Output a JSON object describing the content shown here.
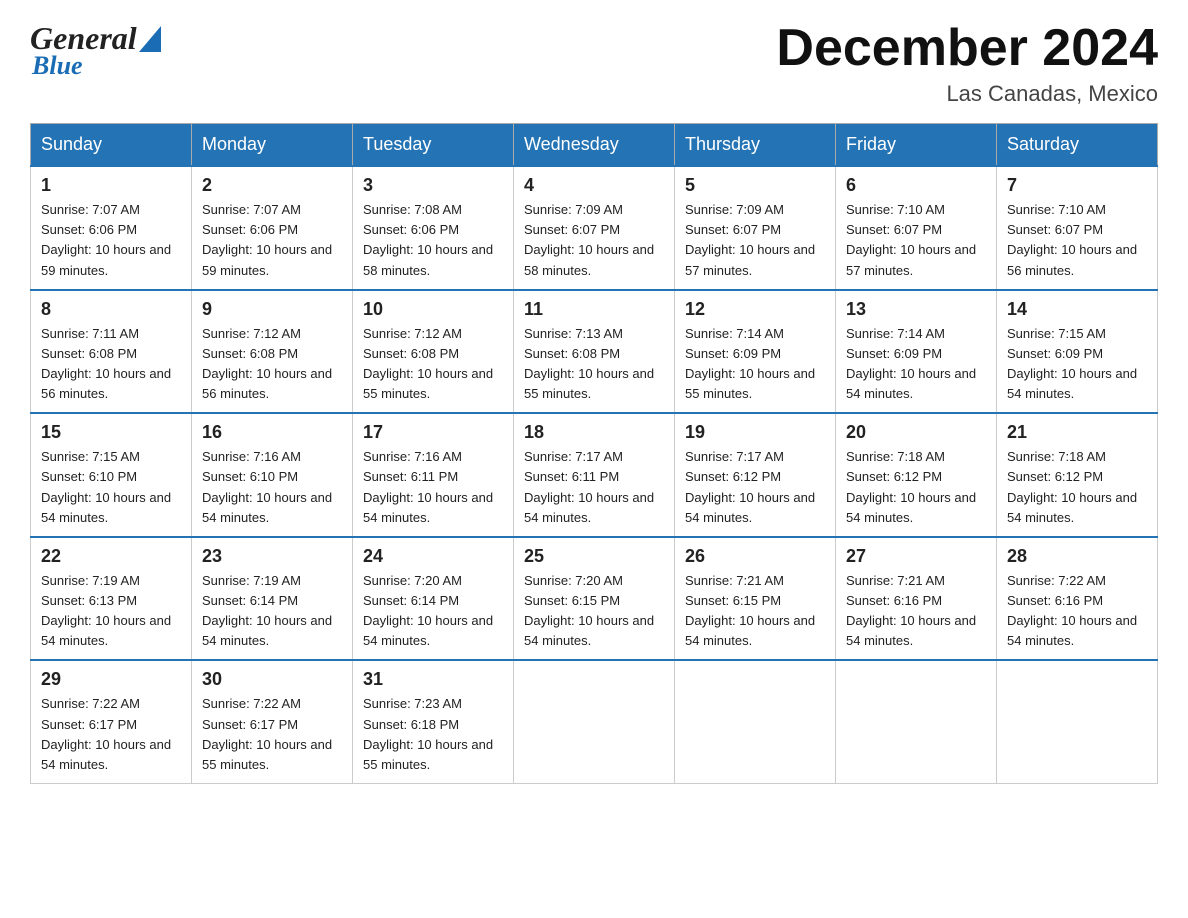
{
  "header": {
    "logo_general": "General",
    "logo_blue": "Blue",
    "month_title": "December 2024",
    "location": "Las Canadas, Mexico"
  },
  "days_of_week": [
    "Sunday",
    "Monday",
    "Tuesday",
    "Wednesday",
    "Thursday",
    "Friday",
    "Saturday"
  ],
  "weeks": [
    [
      {
        "day": "1",
        "sunrise": "7:07 AM",
        "sunset": "6:06 PM",
        "daylight": "10 hours and 59 minutes."
      },
      {
        "day": "2",
        "sunrise": "7:07 AM",
        "sunset": "6:06 PM",
        "daylight": "10 hours and 59 minutes."
      },
      {
        "day": "3",
        "sunrise": "7:08 AM",
        "sunset": "6:06 PM",
        "daylight": "10 hours and 58 minutes."
      },
      {
        "day": "4",
        "sunrise": "7:09 AM",
        "sunset": "6:07 PM",
        "daylight": "10 hours and 58 minutes."
      },
      {
        "day": "5",
        "sunrise": "7:09 AM",
        "sunset": "6:07 PM",
        "daylight": "10 hours and 57 minutes."
      },
      {
        "day": "6",
        "sunrise": "7:10 AM",
        "sunset": "6:07 PM",
        "daylight": "10 hours and 57 minutes."
      },
      {
        "day": "7",
        "sunrise": "7:10 AM",
        "sunset": "6:07 PM",
        "daylight": "10 hours and 56 minutes."
      }
    ],
    [
      {
        "day": "8",
        "sunrise": "7:11 AM",
        "sunset": "6:08 PM",
        "daylight": "10 hours and 56 minutes."
      },
      {
        "day": "9",
        "sunrise": "7:12 AM",
        "sunset": "6:08 PM",
        "daylight": "10 hours and 56 minutes."
      },
      {
        "day": "10",
        "sunrise": "7:12 AM",
        "sunset": "6:08 PM",
        "daylight": "10 hours and 55 minutes."
      },
      {
        "day": "11",
        "sunrise": "7:13 AM",
        "sunset": "6:08 PM",
        "daylight": "10 hours and 55 minutes."
      },
      {
        "day": "12",
        "sunrise": "7:14 AM",
        "sunset": "6:09 PM",
        "daylight": "10 hours and 55 minutes."
      },
      {
        "day": "13",
        "sunrise": "7:14 AM",
        "sunset": "6:09 PM",
        "daylight": "10 hours and 54 minutes."
      },
      {
        "day": "14",
        "sunrise": "7:15 AM",
        "sunset": "6:09 PM",
        "daylight": "10 hours and 54 minutes."
      }
    ],
    [
      {
        "day": "15",
        "sunrise": "7:15 AM",
        "sunset": "6:10 PM",
        "daylight": "10 hours and 54 minutes."
      },
      {
        "day": "16",
        "sunrise": "7:16 AM",
        "sunset": "6:10 PM",
        "daylight": "10 hours and 54 minutes."
      },
      {
        "day": "17",
        "sunrise": "7:16 AM",
        "sunset": "6:11 PM",
        "daylight": "10 hours and 54 minutes."
      },
      {
        "day": "18",
        "sunrise": "7:17 AM",
        "sunset": "6:11 PM",
        "daylight": "10 hours and 54 minutes."
      },
      {
        "day": "19",
        "sunrise": "7:17 AM",
        "sunset": "6:12 PM",
        "daylight": "10 hours and 54 minutes."
      },
      {
        "day": "20",
        "sunrise": "7:18 AM",
        "sunset": "6:12 PM",
        "daylight": "10 hours and 54 minutes."
      },
      {
        "day": "21",
        "sunrise": "7:18 AM",
        "sunset": "6:12 PM",
        "daylight": "10 hours and 54 minutes."
      }
    ],
    [
      {
        "day": "22",
        "sunrise": "7:19 AM",
        "sunset": "6:13 PM",
        "daylight": "10 hours and 54 minutes."
      },
      {
        "day": "23",
        "sunrise": "7:19 AM",
        "sunset": "6:14 PM",
        "daylight": "10 hours and 54 minutes."
      },
      {
        "day": "24",
        "sunrise": "7:20 AM",
        "sunset": "6:14 PM",
        "daylight": "10 hours and 54 minutes."
      },
      {
        "day": "25",
        "sunrise": "7:20 AM",
        "sunset": "6:15 PM",
        "daylight": "10 hours and 54 minutes."
      },
      {
        "day": "26",
        "sunrise": "7:21 AM",
        "sunset": "6:15 PM",
        "daylight": "10 hours and 54 minutes."
      },
      {
        "day": "27",
        "sunrise": "7:21 AM",
        "sunset": "6:16 PM",
        "daylight": "10 hours and 54 minutes."
      },
      {
        "day": "28",
        "sunrise": "7:22 AM",
        "sunset": "6:16 PM",
        "daylight": "10 hours and 54 minutes."
      }
    ],
    [
      {
        "day": "29",
        "sunrise": "7:22 AM",
        "sunset": "6:17 PM",
        "daylight": "10 hours and 54 minutes."
      },
      {
        "day": "30",
        "sunrise": "7:22 AM",
        "sunset": "6:17 PM",
        "daylight": "10 hours and 55 minutes."
      },
      {
        "day": "31",
        "sunrise": "7:23 AM",
        "sunset": "6:18 PM",
        "daylight": "10 hours and 55 minutes."
      },
      null,
      null,
      null,
      null
    ]
  ]
}
